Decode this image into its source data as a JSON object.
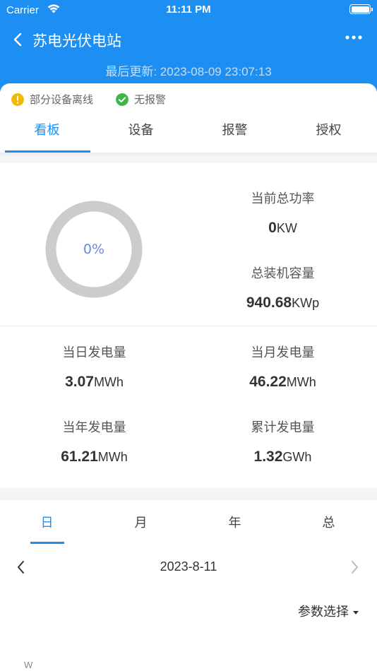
{
  "status_bar": {
    "carrier": "Carrier",
    "time": "11:11 PM"
  },
  "nav": {
    "title": "苏电光伏电站",
    "update_time": "最后更新: 2023-08-09 23:07:13"
  },
  "chips": [
    {
      "label": "部分设备离线",
      "color": "#f5b800"
    },
    {
      "label": "无报警",
      "color": "#3cb64a"
    }
  ],
  "tabs": [
    {
      "label": "看板",
      "active": true
    },
    {
      "label": "设备"
    },
    {
      "label": "报警"
    },
    {
      "label": "授权"
    }
  ],
  "ring": {
    "label": "0%",
    "value": 0
  },
  "stats": {
    "current_power": {
      "title": "当前总功率",
      "value": "0",
      "unit": "KW"
    },
    "installed": {
      "title": "总装机容量",
      "value": "940.68",
      "unit": "KWp"
    },
    "day": {
      "title": "当日发电量",
      "value": "3.07",
      "unit": "MWh"
    },
    "month": {
      "title": "当月发电量",
      "value": "46.22",
      "unit": "MWh"
    },
    "year": {
      "title": "当年发电量",
      "value": "61.21",
      "unit": "MWh"
    },
    "total": {
      "title": "累计发电量",
      "value": "1.32",
      "unit": "GWh"
    }
  },
  "period_tabs": [
    {
      "label": "日",
      "active": true
    },
    {
      "label": "月"
    },
    {
      "label": "年"
    },
    {
      "label": "总"
    }
  ],
  "date": "2023-8-11",
  "param_select": "参数选择",
  "chart_unit": "W",
  "colors": {
    "primary": "#1e8ff2",
    "ring": "#cccccc",
    "ring_label": "#6b86d8"
  }
}
